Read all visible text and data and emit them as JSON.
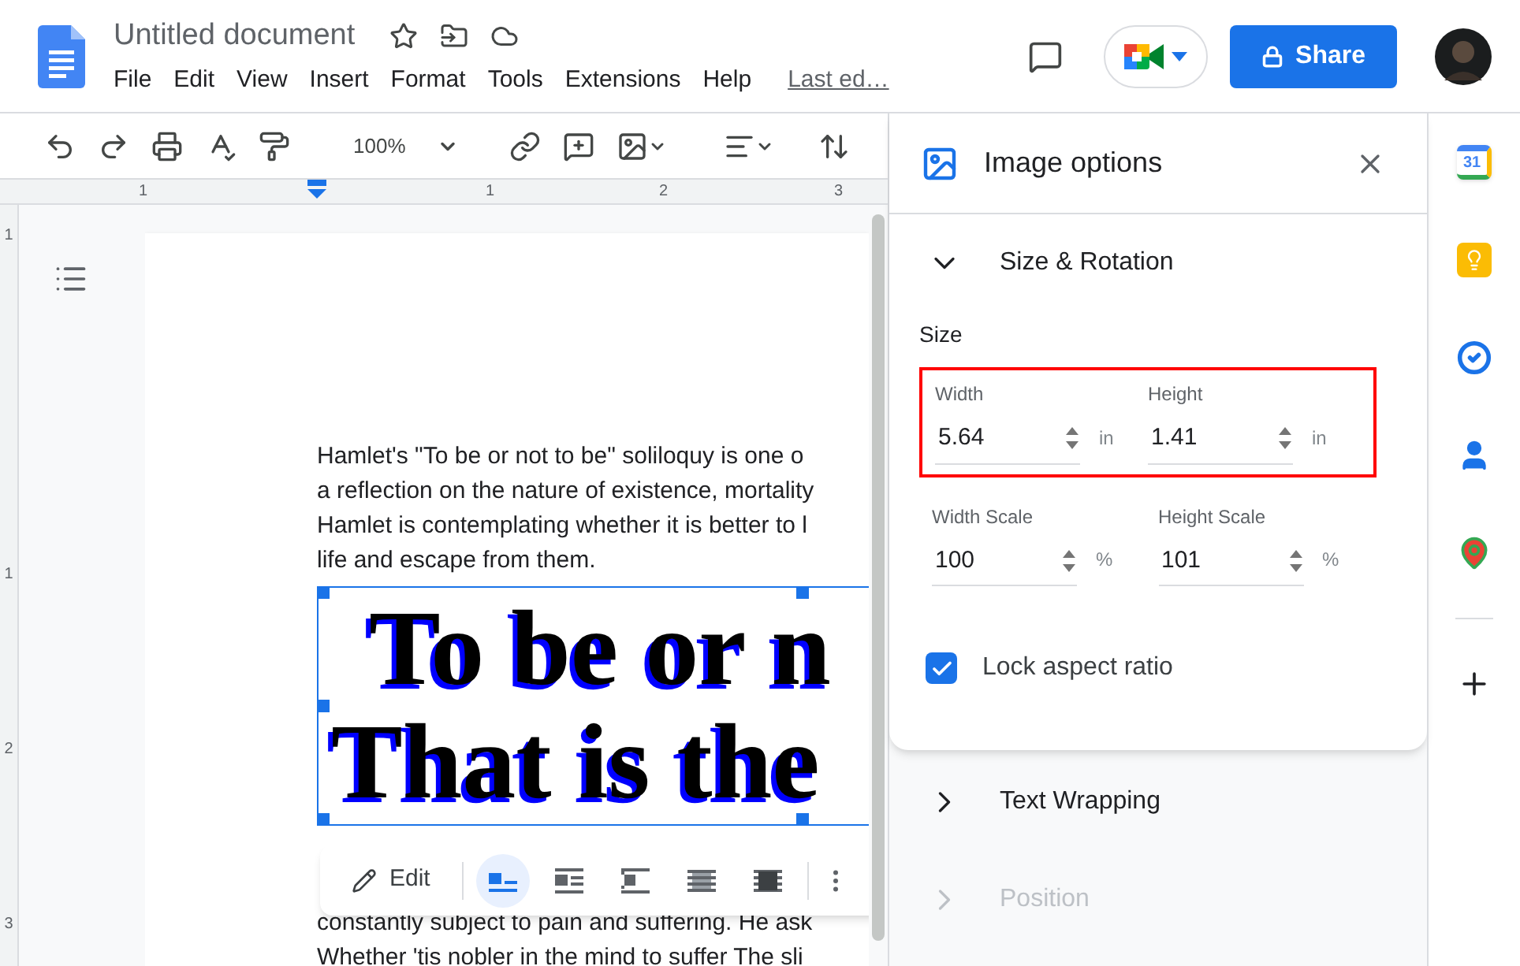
{
  "document": {
    "title": "Untitled document",
    "last_edit": "Last ed…"
  },
  "menu": [
    "File",
    "Edit",
    "View",
    "Insert",
    "Format",
    "Tools",
    "Extensions",
    "Help"
  ],
  "share": {
    "label": "Share"
  },
  "toolbar": {
    "zoom": "100%"
  },
  "ruler": {
    "marks": [
      "1",
      "1",
      "2",
      "3"
    ]
  },
  "vertical_ruler": {
    "marks": [
      "1",
      "1",
      "2",
      "3"
    ]
  },
  "page": {
    "paragraph_lines": [
      "Hamlet's \"To be or not to be\" soliloquy is one o",
      "a reflection on the nature of existence, mortality",
      "Hamlet is contemplating whether it is better to l",
      "life and escape from them."
    ],
    "image_lines": [
      "To be or n",
      "That is the"
    ],
    "after_lines": [
      "constantly subject to pain and suffering. He ask",
      "Whether 'tis nobler in the mind to suffer The sli"
    ]
  },
  "image_toolbar": {
    "edit": "Edit",
    "wrap_modes": [
      {
        "kind": "inline",
        "selected": true
      },
      {
        "kind": "wrap",
        "selected": false
      },
      {
        "kind": "break",
        "selected": false
      },
      {
        "kind": "behind",
        "selected": false
      },
      {
        "kind": "front",
        "selected": false
      }
    ]
  },
  "panel": {
    "title": "Image options",
    "sections": [
      {
        "title": "Size & Rotation",
        "expanded": true,
        "disabled": false
      },
      {
        "title": "Text Wrapping",
        "expanded": false,
        "disabled": false
      },
      {
        "title": "Position",
        "expanded": false,
        "disabled": true
      }
    ],
    "size_heading": "Size",
    "fields": [
      {
        "label": "Width",
        "value": "5.64",
        "unit": "in",
        "highlighted": true
      },
      {
        "label": "Height",
        "value": "1.41",
        "unit": "in",
        "highlighted": true
      },
      {
        "label": "Width Scale",
        "value": "100",
        "unit": "%",
        "highlighted": false
      },
      {
        "label": "Height Scale",
        "value": "101",
        "unit": "%",
        "highlighted": false
      }
    ],
    "lock": {
      "label": "Lock aspect ratio",
      "checked": true
    }
  },
  "apps": {
    "calendar_day": "31"
  }
}
